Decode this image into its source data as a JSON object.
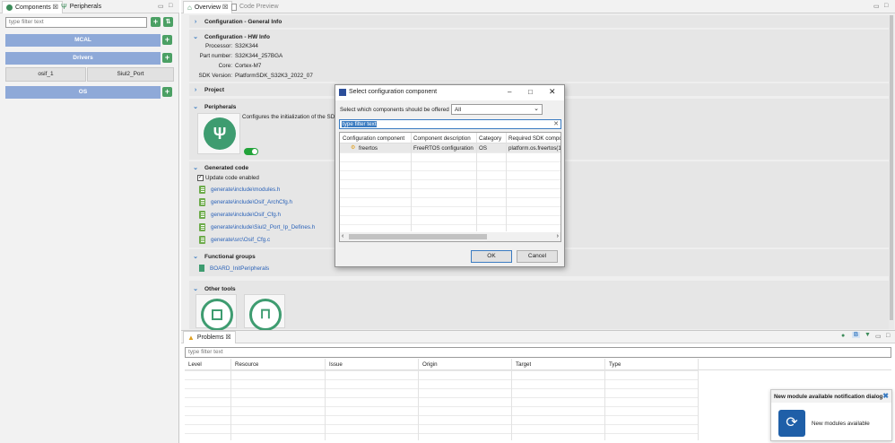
{
  "left_panel": {
    "tabs": [
      {
        "label": "Components ☒"
      },
      {
        "label": "Peripherals"
      }
    ],
    "filter_placeholder": "type filter text",
    "groups": [
      {
        "label": "MCAL"
      },
      {
        "label": "Drivers"
      },
      {
        "label": "OS"
      }
    ],
    "driver_items": [
      "osif_1",
      "Siul2_Port"
    ]
  },
  "editor": {
    "tabs": [
      {
        "label": "Overview ☒"
      },
      {
        "label": "Code Preview"
      }
    ],
    "sections": {
      "general_info": "Configuration - General Info",
      "hw_info": "Configuration - HW Info",
      "project": "Project",
      "peripherals": "Peripherals",
      "generated_code": "Generated code",
      "functional_groups": "Functional groups",
      "other_tools": "Other tools"
    },
    "hw_info": {
      "rows": [
        {
          "label": "Processor:",
          "value": "S32K344"
        },
        {
          "label": "Part number:",
          "value": "S32K344_257BGA"
        },
        {
          "label": "Core:",
          "value": "Cortex-M7"
        },
        {
          "label": "SDK Version:",
          "value": "PlatformSDK_S32K3_2022_07"
        }
      ]
    },
    "peripherals_desc": "Configures the initialization of the SDK",
    "update_code_label": "Update code enabled",
    "generated_files": [
      "generate\\include\\modules.h",
      "generate\\include\\Osif_ArchCfg.h",
      "generate\\include\\Osif_Cfg.h",
      "generate\\include\\Siul2_Port_Ip_Defines.h",
      "generate\\src\\Osif_Cfg.c"
    ],
    "functional_group_item": "BOARD_InitPeripherals"
  },
  "problems": {
    "tab_label": "Problems ☒",
    "filter_placeholder": "type filter text",
    "columns": [
      "Level",
      "Resource",
      "Issue",
      "Origin",
      "Target",
      "Type"
    ]
  },
  "dialog": {
    "title": "Select configuration component",
    "offer_label": "Select which components should be offered",
    "offer_value": "All",
    "filter_value": "type filter text",
    "columns": [
      "Configuration component",
      "Component description",
      "Category",
      "Required SDK compo"
    ],
    "rows": [
      {
        "component": "freertos",
        "description": "FreeRTOS configuration",
        "category": "OS",
        "sdk": "platform.os.freertos(1"
      }
    ],
    "ok_label": "OK",
    "cancel_label": "Cancel"
  },
  "notification": {
    "title": "New module available notification dialog",
    "message": "New modules available"
  },
  "colors": {
    "accent": "#2a62b8",
    "group_bar": "#8ea9d8",
    "green": "#4ba064",
    "toggle_green": "#22a33a"
  }
}
